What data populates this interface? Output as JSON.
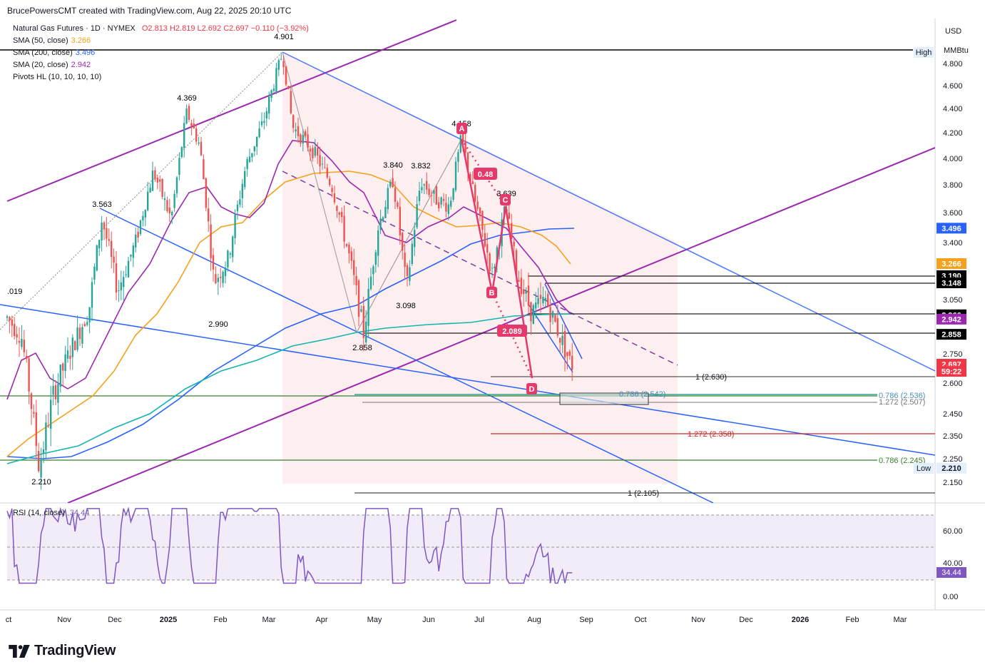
{
  "header": {
    "text": "BrucePowersCMT created with TradingView.com, Aug 22, 2025 20:10 UTC"
  },
  "legend": {
    "title": "Natural Gas Futures · 1D · NYMEX",
    "ohlc": "O2.813  H2.819  L2.692  C2.697  −0.110 (−3.92%)",
    "sma50": {
      "label": "SMA (50, close)",
      "value": "3.266",
      "color": "#f5a21a"
    },
    "sma200": {
      "label": "SMA (200, close)",
      "value": "3.496",
      "color": "#2962ff"
    },
    "sma20": {
      "label": "SMA (20, close)",
      "value": "2.942",
      "color": "#9c27b0"
    },
    "pivots": {
      "label": "Pivots HL (10, 10, 10, 10)"
    }
  },
  "axis": {
    "currency": "USD",
    "unit": "MMBtu",
    "high_label": "High",
    "low_label": "Low"
  },
  "rsi": {
    "label": "RSI (14, close)",
    "value": "34.44",
    "ticks": [
      "60.00",
      "40.00",
      "0.00"
    ]
  },
  "logo": {
    "text": "TradingView"
  },
  "chart_data": {
    "type": "candlestick",
    "y_axis": {
      "ticks": [
        4.8,
        4.6,
        4.4,
        4.2,
        4.0,
        3.8,
        3.6,
        3.4,
        3.05,
        2.75,
        2.6,
        2.45,
        2.35,
        2.25,
        2.15
      ],
      "ylim": [
        2.09,
        5.0
      ]
    },
    "x_ticks": [
      "ct",
      "Nov",
      "Dec",
      "2025",
      "Feb",
      "Mar",
      "Apr",
      "May",
      "Jun",
      "Jul",
      "Aug",
      "Sep",
      "Oct",
      "Nov",
      "Dec",
      "2026",
      "Feb",
      "Mar"
    ],
    "price_tags": [
      {
        "text": "3.496",
        "price": 3.496,
        "bg": "#2962ff",
        "fg": "#ffffff"
      },
      {
        "text": "3.266",
        "price": 3.266,
        "bg": "#f5a21a",
        "fg": "#ffffff"
      },
      {
        "text": "3.190",
        "price": 3.19,
        "bg": "#000000",
        "fg": "#ffffff"
      },
      {
        "text": "3.148",
        "price": 3.148,
        "bg": "#000000",
        "fg": "#ffffff"
      },
      {
        "text": "2.966",
        "price": 2.966,
        "bg": "#000000",
        "fg": "#ffffff"
      },
      {
        "text": "2.942",
        "price": 2.942,
        "bg": "#9c27b0",
        "fg": "#ffffff"
      },
      {
        "text": "2.858",
        "price": 2.858,
        "bg": "#000000",
        "fg": "#ffffff"
      },
      {
        "text": "2.697",
        "price": 2.697,
        "bg": "#f23645",
        "fg": "#ffffff"
      },
      {
        "text": "59:22",
        "price": 2.66,
        "bg": "#f23645",
        "fg": "#ffffff"
      },
      {
        "text": "2.210",
        "price": 2.21,
        "bg": "#e3effd",
        "fg": "#131722"
      }
    ],
    "pivot_labels": [
      {
        "text": "4.901",
        "price": 4.901
      },
      {
        "text": "4.369",
        "price": 4.369
      },
      {
        "text": "3.563",
        "price": 3.563
      },
      {
        "text": ".019",
        "price": 3.019
      },
      {
        "text": "2.990",
        "price": 2.99
      },
      {
        "text": "2.210",
        "price": 2.21
      },
      {
        "text": "3.840",
        "price": 3.84
      },
      {
        "text": "3.832",
        "price": 3.832
      },
      {
        "text": "4.158",
        "price": 4.158
      },
      {
        "text": "3.639",
        "price": 3.639
      },
      {
        "text": "3.098",
        "price": 3.098
      },
      {
        "text": "2.858",
        "price": 2.858
      }
    ],
    "pattern": {
      "points": [
        "A",
        "B",
        "C",
        "D"
      ],
      "ratio_label": "0.48",
      "level_label": "2.089"
    },
    "fib_levels": [
      {
        "text": "1 (2.630)",
        "price": 2.63
      },
      {
        "text": "0.786 (2.542)",
        "price": 2.542
      },
      {
        "text": "0.786 (2.536)",
        "price": 2.536
      },
      {
        "text": "1.272 (2.507)",
        "price": 2.507
      },
      {
        "text": "1.272 (2.358)",
        "price": 2.358
      },
      {
        "text": "0.786 (2.245)",
        "price": 2.245
      },
      {
        "text": "1 (2.105)",
        "price": 2.105
      }
    ],
    "last": {
      "open": 2.813,
      "high": 2.819,
      "low": 2.692,
      "close": 2.697
    }
  }
}
